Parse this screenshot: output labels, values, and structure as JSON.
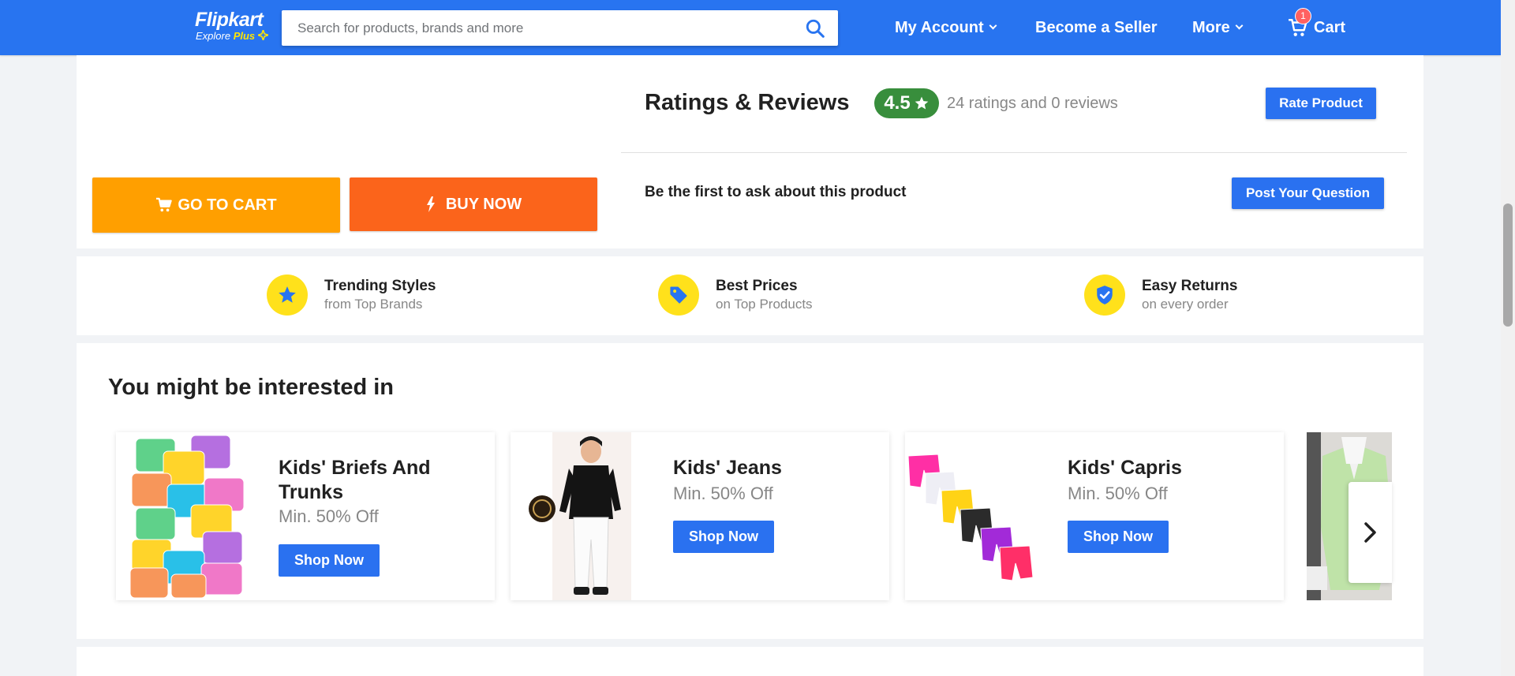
{
  "header": {
    "logo_brand": "Flipkart",
    "logo_sub": "Explore",
    "logo_plus": "Plus",
    "search_placeholder": "Search for products, brands and more",
    "nav": {
      "account": "My Account",
      "seller": "Become a Seller",
      "more": "More",
      "cart": "Cart",
      "cart_count": "1"
    }
  },
  "actions": {
    "go_to_cart": "GO TO CART",
    "buy_now": "BUY NOW"
  },
  "ratings": {
    "title": "Ratings & Reviews",
    "score": "4.5",
    "summary": "24 ratings and 0 reviews",
    "rate_button": "Rate Product"
  },
  "questions": {
    "prompt": "Be the first to ask about this product",
    "post_button": "Post Your Question"
  },
  "features": [
    {
      "title": "Trending Styles",
      "subtitle": "from Top Brands",
      "icon": "star-icon"
    },
    {
      "title": "Best Prices",
      "subtitle": "on Top Products",
      "icon": "tag-icon"
    },
    {
      "title": "Easy Returns",
      "subtitle": "on every order",
      "icon": "shield-check-icon"
    }
  ],
  "interest": {
    "title": "You might be interested in",
    "cards": [
      {
        "name": "Kids' Briefs And Trunks",
        "offer": "Min. 50% Off",
        "cta": "Shop Now"
      },
      {
        "name": "Kids' Jeans",
        "offer": "Min. 50% Off",
        "cta": "Shop Now"
      },
      {
        "name": "Kids' Capris",
        "offer": "Min. 50% Off",
        "cta": "Shop Now"
      }
    ]
  },
  "colors": {
    "brand_blue": "#2874f0",
    "cart_orange": "#ff9f00",
    "buy_orange": "#fb641b",
    "rating_green": "#388e3c",
    "feature_yellow": "#ffe11b"
  }
}
